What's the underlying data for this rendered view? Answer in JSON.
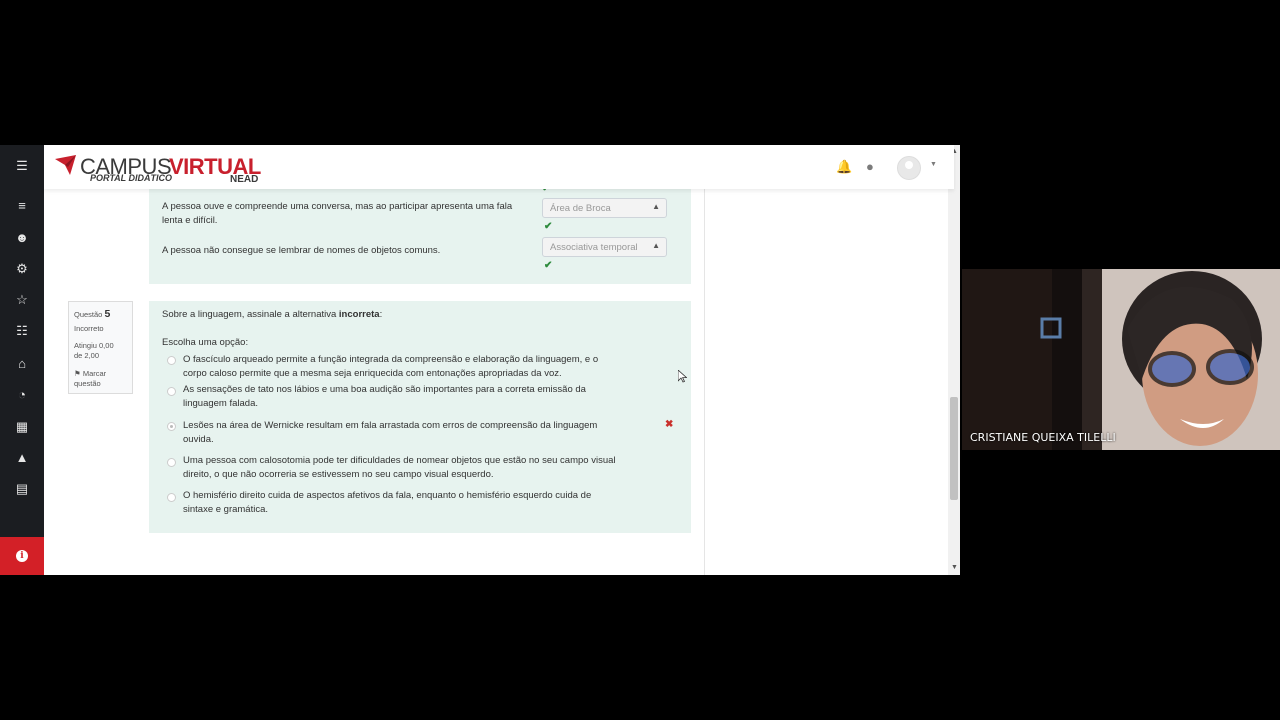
{
  "brand": {
    "campus": "CAMPUS",
    "virtual": "VIRTUAL",
    "portal": "PORTAL DIDÁTICO",
    "nead": "NEAD",
    "colors": {
      "red": "#c8202d",
      "dark": "#3a3a3a"
    }
  },
  "sidebar": {
    "items": [
      {
        "icon": "menu-icon"
      },
      {
        "icon": "list-icon"
      },
      {
        "icon": "users-icon"
      },
      {
        "icon": "badge-icon"
      },
      {
        "icon": "star-icon"
      },
      {
        "icon": "book-icon"
      },
      {
        "icon": "home-icon"
      },
      {
        "icon": "dashboard-icon"
      },
      {
        "icon": "calendar-icon"
      },
      {
        "icon": "graduation-icon"
      },
      {
        "icon": "files-icon"
      }
    ],
    "info_icon": "info-icon"
  },
  "question4": {
    "rows": [
      {
        "text": "A pessoa ouve e compreende uma conversa, mas ao participar apresenta uma fala lenta e difícil.",
        "answer": "Área de Broca"
      },
      {
        "text": "A pessoa não consegue se lembrar de nomes de objetos comuns.",
        "answer": "Associativa temporal"
      }
    ]
  },
  "question5": {
    "info": {
      "label": "Questão",
      "number": "5",
      "status": "Incorreto",
      "score_line1": "Atingiu 0,00",
      "score_line2": "de 2,00",
      "flag_line1": "Marcar",
      "flag_line2": "questão"
    },
    "prompt_before": "Sobre a linguagem, assinale a alternativa ",
    "prompt_bold": "incorreta",
    "prompt_after": ":",
    "choose": "Escolha uma opção:",
    "options": [
      {
        "line1": "O fascículo arqueado permite a função integrada da compreensão e elaboração da linguagem, e o",
        "line2": "corpo caloso permite que a mesma seja enriquecida com entonações apropriadas da voz."
      },
      {
        "line1": "As sensações de tato nos lábios e uma boa audição são importantes para a correta emissão da",
        "line2": "linguagem falada."
      },
      {
        "line1": "Lesões na área de Wernicke resultam em fala arrastada com erros de compreensão da linguagem",
        "line2": "ouvida."
      },
      {
        "line1": "Uma pessoa com calosotomia pode ter dificuldades de nomear objetos que estão no seu campo visual",
        "line2": "direito, o que não ocorreria se estivessem no seu campo visual esquerdo."
      },
      {
        "line1": "O hemisfério direito cuida de aspectos afetivos da fala, enquanto o hemisfério esquerdo cuida de",
        "line2": "sintaxe e gramática."
      }
    ],
    "selected_index": 2
  },
  "video": {
    "participant": "CRISTIANE QUEIXA TILELLI"
  }
}
